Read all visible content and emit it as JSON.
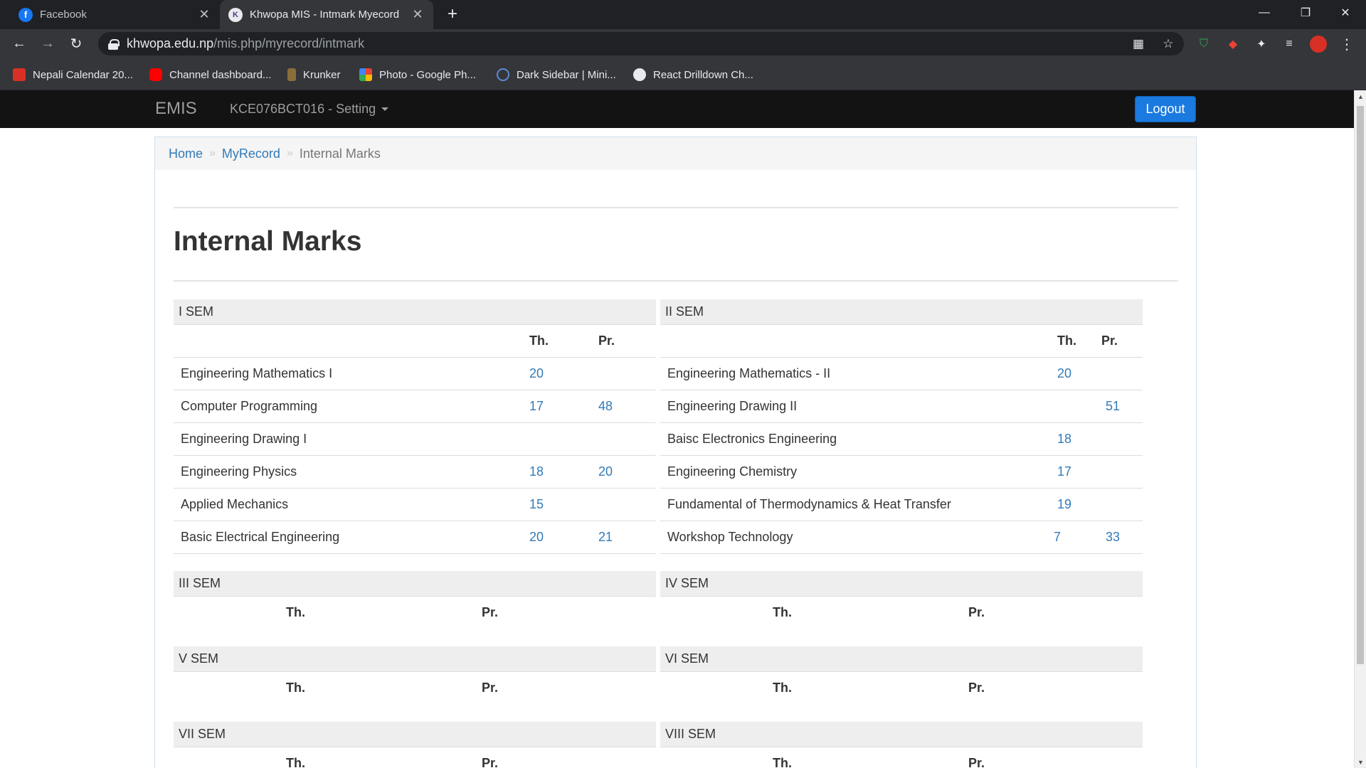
{
  "browser": {
    "tabs": [
      {
        "title": "Facebook",
        "active": false
      },
      {
        "title": "Khwopa MIS - Intmark Myecord",
        "active": true
      }
    ],
    "url_host": "khwopa.edu.np",
    "url_path": "/mis.php/myrecord/intmark",
    "bookmarks": [
      "Nepali Calendar 20...",
      "Channel dashboard...",
      "Krunker",
      "Photo - Google Ph...",
      "Dark Sidebar | Mini...",
      "React Drilldown Ch..."
    ]
  },
  "navbar": {
    "brand": "EMIS",
    "menu": "KCE076BCT016 - Setting",
    "logout": "Logout"
  },
  "breadcrumb": {
    "home": "Home",
    "myrecord": "MyRecord",
    "current": "Internal Marks",
    "separator": "»"
  },
  "page_title": "Internal Marks",
  "columns": {
    "th": "Th.",
    "pr": "Pr."
  },
  "semesters": [
    {
      "name": "I SEM",
      "subjects": [
        {
          "name": "Engineering Mathematics I",
          "th": "20",
          "pr": ""
        },
        {
          "name": "Computer Programming",
          "th": "17",
          "pr": "48"
        },
        {
          "name": "Engineering Drawing I",
          "th": "",
          "pr": ""
        },
        {
          "name": "Engineering Physics",
          "th": "18",
          "pr": "20"
        },
        {
          "name": "Applied Mechanics",
          "th": "15",
          "pr": ""
        },
        {
          "name": "Basic Electrical Engineering",
          "th": "20",
          "pr": "21"
        }
      ]
    },
    {
      "name": "II SEM",
      "subjects": [
        {
          "name": "Engineering Mathematics - II",
          "th": "20",
          "pr": ""
        },
        {
          "name": "Engineering Drawing II",
          "th": "",
          "pr": "51"
        },
        {
          "name": "Baisc Electronics Engineering",
          "th": "18",
          "pr": ""
        },
        {
          "name": "Engineering Chemistry",
          "th": "17",
          "pr": ""
        },
        {
          "name": "Fundamental of Thermodynamics & Heat Transfer",
          "th": "19",
          "pr": ""
        },
        {
          "name": "Workshop Technology",
          "th": "7",
          "pr": "33"
        }
      ]
    },
    {
      "name": "III SEM",
      "subjects": []
    },
    {
      "name": "IV SEM",
      "subjects": []
    },
    {
      "name": "V SEM",
      "subjects": []
    },
    {
      "name": "VI SEM",
      "subjects": []
    },
    {
      "name": "VII SEM",
      "subjects": []
    },
    {
      "name": "VIII SEM",
      "subjects": []
    }
  ]
}
